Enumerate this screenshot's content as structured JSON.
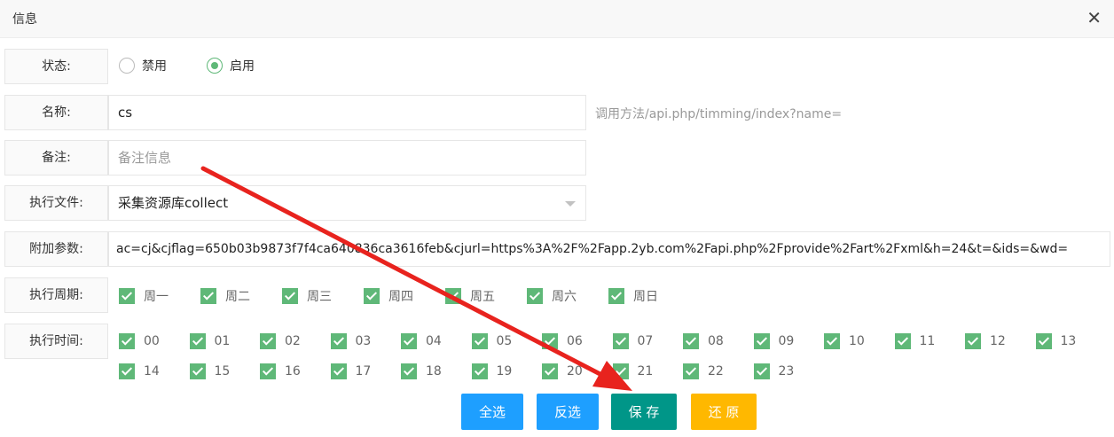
{
  "dialog": {
    "title": "信息",
    "close_icon": "✕"
  },
  "fields": {
    "status": {
      "label": "状态:",
      "options": [
        "禁用",
        "启用"
      ],
      "selected": "启用"
    },
    "name": {
      "label": "名称:",
      "value": "cs",
      "hint": "调用方法/api.php/timming/index?name="
    },
    "remark": {
      "label": "备注:",
      "placeholder": "备注信息"
    },
    "file": {
      "label": "执行文件:",
      "value": "采集资源库collect"
    },
    "params": {
      "label": "附加参数:",
      "value": "ac=cj&cjflag=650b03b9873f7f4ca640836ca3616feb&cjurl=https%3A%2F%2Fapp.2yb.com%2Fapi.php%2Fprovide%2Fart%2Fxml&h=24&t=&ids=&wd="
    },
    "weekdays": {
      "label": "执行周期:",
      "items": [
        "周一",
        "周二",
        "周三",
        "周四",
        "周五",
        "周六",
        "周日"
      ]
    },
    "hours": {
      "label": "执行时间:",
      "items": [
        "00",
        "01",
        "02",
        "03",
        "04",
        "05",
        "06",
        "07",
        "08",
        "09",
        "10",
        "11",
        "12",
        "13",
        "14",
        "15",
        "16",
        "17",
        "18",
        "19",
        "20",
        "21",
        "22",
        "23"
      ]
    }
  },
  "buttons": {
    "select_all": "全选",
    "invert": "反选",
    "save": "保 存",
    "reset": "还 原"
  },
  "colors": {
    "green": "#5fb878",
    "blue": "#1e9fff",
    "teal": "#009688",
    "orange": "#ffb800",
    "annotation_arrow": "#e8231e"
  }
}
